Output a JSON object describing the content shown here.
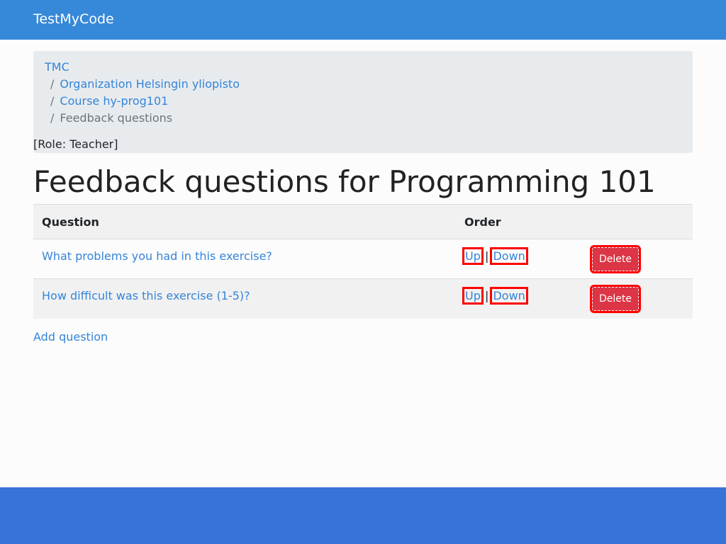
{
  "nav": {
    "brand": "TestMyCode"
  },
  "breadcrumb": {
    "items": [
      "TMC",
      "Organization Helsingin yliopisto",
      "Course hy-prog101"
    ],
    "current": "Feedback questions",
    "separator": "/",
    "role": "[Role: Teacher]"
  },
  "title": "Feedback questions for Programming 101",
  "table": {
    "headers": [
      "Question",
      "Order"
    ],
    "rows": [
      {
        "question": "What problems you had in this exercise?",
        "up": "Up",
        "sep": "|",
        "down": "Down",
        "delete": "Delete"
      },
      {
        "question": "How difficult was this exercise (1-5)?",
        "up": "Up",
        "sep": "|",
        "down": "Down",
        "delete": "Delete"
      }
    ]
  },
  "add_question": "Add question"
}
